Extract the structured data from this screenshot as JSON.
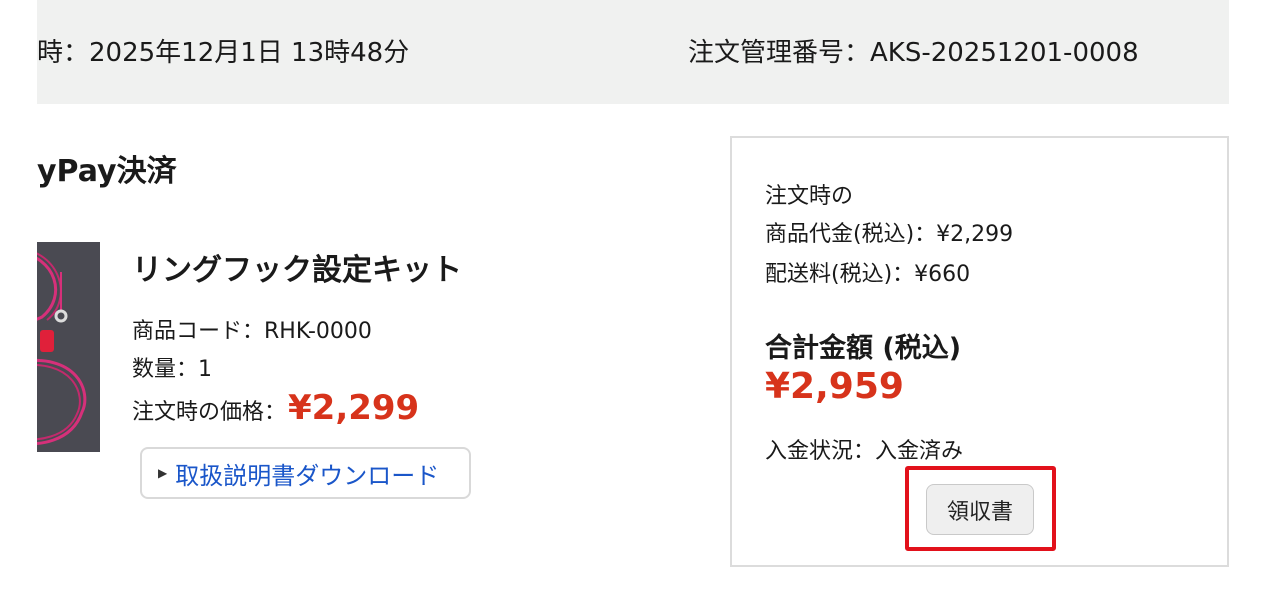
{
  "order_header": {
    "date_text": "時：2025年12月1日 13時48分",
    "order_number_text": "注文管理番号：AKS-20251201-0008"
  },
  "payment_method": "yPay決済",
  "product": {
    "thumbnail_icon": "product-photo",
    "name": "リングフック設定キット",
    "code_text": "商品コード：RHK-0000",
    "quantity_text": "数量：1",
    "price_label": "注文時の価格：",
    "price_value": "¥2,299",
    "manual_download_label": "取扱説明書ダウンロード"
  },
  "summary": {
    "line1": "注文時の",
    "line2": "商品代金(税込)：¥2,299",
    "line3": "配送料(税込)：¥660",
    "total_label": "合計金額 (税込)",
    "total_value": "¥2,959",
    "payment_status": "入金状況：入金済み",
    "receipt_button_label": "領収書"
  },
  "colors": {
    "price_red": "#d7331b",
    "link_blue": "#1a56c9",
    "highlight_red": "#e2111b",
    "header_bg": "#f0f1f0"
  }
}
